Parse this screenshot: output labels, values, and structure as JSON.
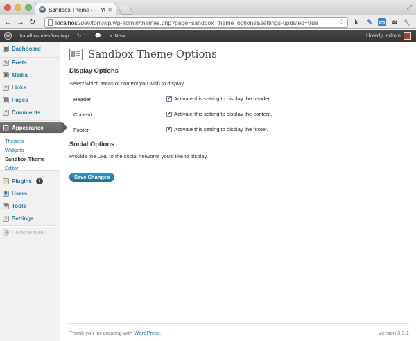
{
  "browser": {
    "tab_title": "Sandbox Theme ‹ — WordPress",
    "url_host": "localhost",
    "url_path": "/dev/tom/wp/wp-admin/themes.php?page=sandbox_theme_options&settings-updated=true"
  },
  "adminbar": {
    "site": "localhost/dev/tom/wp",
    "updates_count": "1",
    "new_label": "New",
    "greeting": "Howdy, admin"
  },
  "sidebar": {
    "items": [
      {
        "label": "Dashboard",
        "icon": "dashboard-icon"
      },
      {
        "label": "Posts",
        "icon": "posts-icon"
      },
      {
        "label": "Media",
        "icon": "media-icon"
      },
      {
        "label": "Links",
        "icon": "links-icon"
      },
      {
        "label": "Pages",
        "icon": "pages-icon"
      },
      {
        "label": "Comments",
        "icon": "comments-icon"
      },
      {
        "label": "Appearance",
        "icon": "appearance-icon"
      },
      {
        "label": "Plugins",
        "icon": "plugins-icon",
        "badge": "1"
      },
      {
        "label": "Users",
        "icon": "users-icon"
      },
      {
        "label": "Tools",
        "icon": "tools-icon"
      },
      {
        "label": "Settings",
        "icon": "settings-icon"
      }
    ],
    "submenu": [
      "Themes",
      "Widgets",
      "Sandbox Theme",
      "Editor"
    ],
    "collapse_label": "Collapse menu"
  },
  "main": {
    "title": "Sandbox Theme Options",
    "display_heading": "Display Options",
    "display_desc": "Select which areas of content you wish to display.",
    "options": [
      {
        "label": "Header",
        "text": "Activate this setting to display the header.",
        "checked": true
      },
      {
        "label": "Content",
        "text": "Activate this setting to display the content.",
        "checked": true
      },
      {
        "label": "Footer",
        "text": "Activate this setting to display the footer.",
        "checked": true
      }
    ],
    "social_heading": "Social Options",
    "social_desc": "Provide the URL to the social networks you'd like to display.",
    "save_label": "Save Changes"
  },
  "footer": {
    "thanks_prefix": "Thank you for creating with ",
    "thanks_link": "WordPress",
    "thanks_suffix": ".",
    "version": "Version 3.3.1"
  },
  "colors": {
    "link": "#21759b",
    "adminbar": "#464646",
    "button": "#21759b"
  }
}
